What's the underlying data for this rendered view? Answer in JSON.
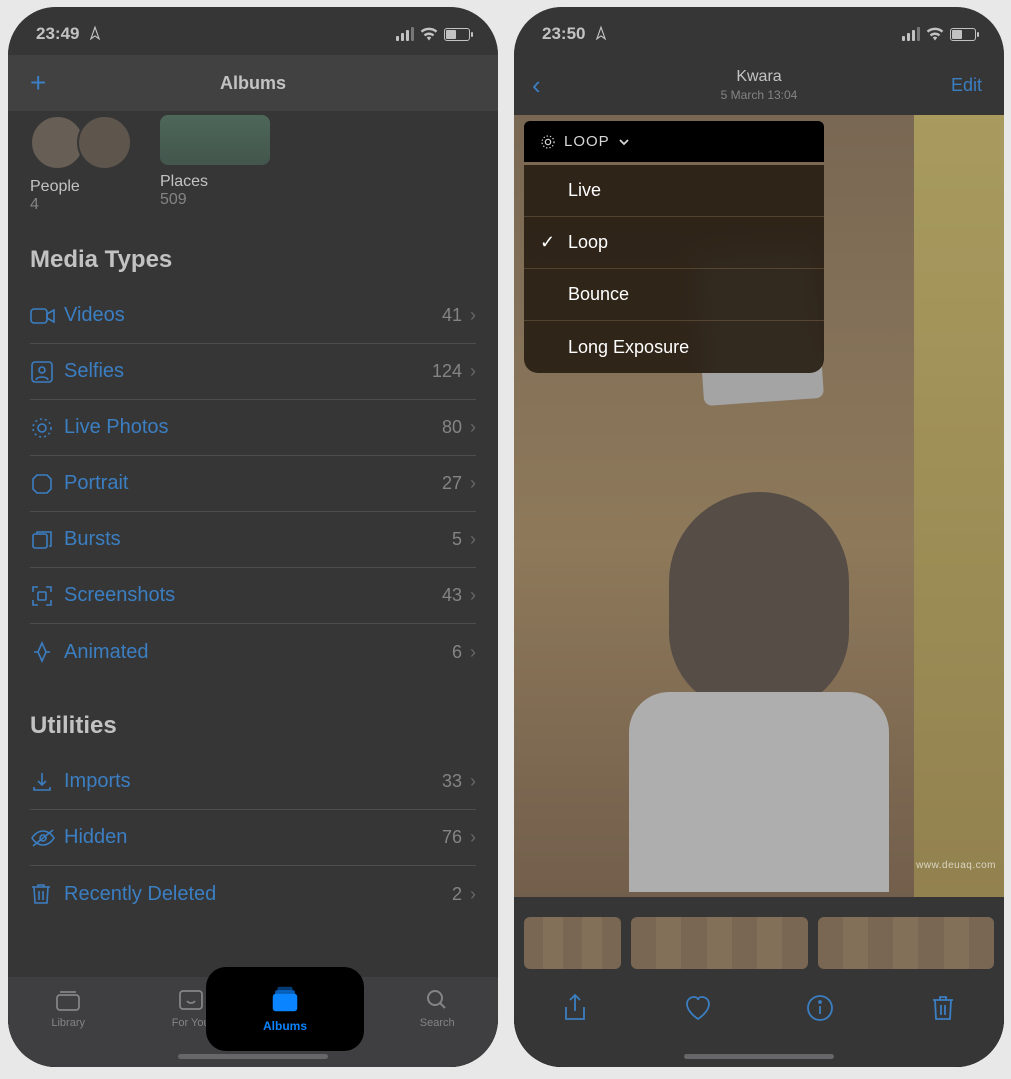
{
  "left": {
    "status": {
      "time": "23:49"
    },
    "nav": {
      "title": "Albums"
    },
    "albums_row": {
      "people": {
        "label": "People",
        "count": "4"
      },
      "places": {
        "label": "Places",
        "count": "509"
      }
    },
    "sections": {
      "media_types": {
        "title": "Media Types",
        "items": [
          {
            "icon": "video-icon",
            "label": "Videos",
            "count": "41"
          },
          {
            "icon": "selfie-icon",
            "label": "Selfies",
            "count": "124"
          },
          {
            "icon": "live-icon",
            "label": "Live Photos",
            "count": "80"
          },
          {
            "icon": "portrait-icon",
            "label": "Portrait",
            "count": "27"
          },
          {
            "icon": "burst-icon",
            "label": "Bursts",
            "count": "5"
          },
          {
            "icon": "screenshot-icon",
            "label": "Screenshots",
            "count": "43"
          },
          {
            "icon": "animated-icon",
            "label": "Animated",
            "count": "6"
          }
        ]
      },
      "utilities": {
        "title": "Utilities",
        "items": [
          {
            "icon": "import-icon",
            "label": "Imports",
            "count": "33"
          },
          {
            "icon": "hidden-icon",
            "label": "Hidden",
            "count": "76"
          },
          {
            "icon": "trash-icon",
            "label": "Recently Deleted",
            "count": "2"
          }
        ]
      }
    },
    "tabs": {
      "library": "Library",
      "for_you": "For You",
      "albums": "Albums",
      "search": "Search"
    }
  },
  "right": {
    "status": {
      "time": "23:50"
    },
    "nav": {
      "location": "Kwara",
      "datetime": "5 March  13:04",
      "edit": "Edit"
    },
    "loop_chip": "LOOP",
    "effect_menu": {
      "items": [
        {
          "label": "Live",
          "selected": false
        },
        {
          "label": "Loop",
          "selected": true
        },
        {
          "label": "Bounce",
          "selected": false
        },
        {
          "label": "Long Exposure",
          "selected": false
        }
      ]
    },
    "watermark": "www.deuaq.com"
  }
}
